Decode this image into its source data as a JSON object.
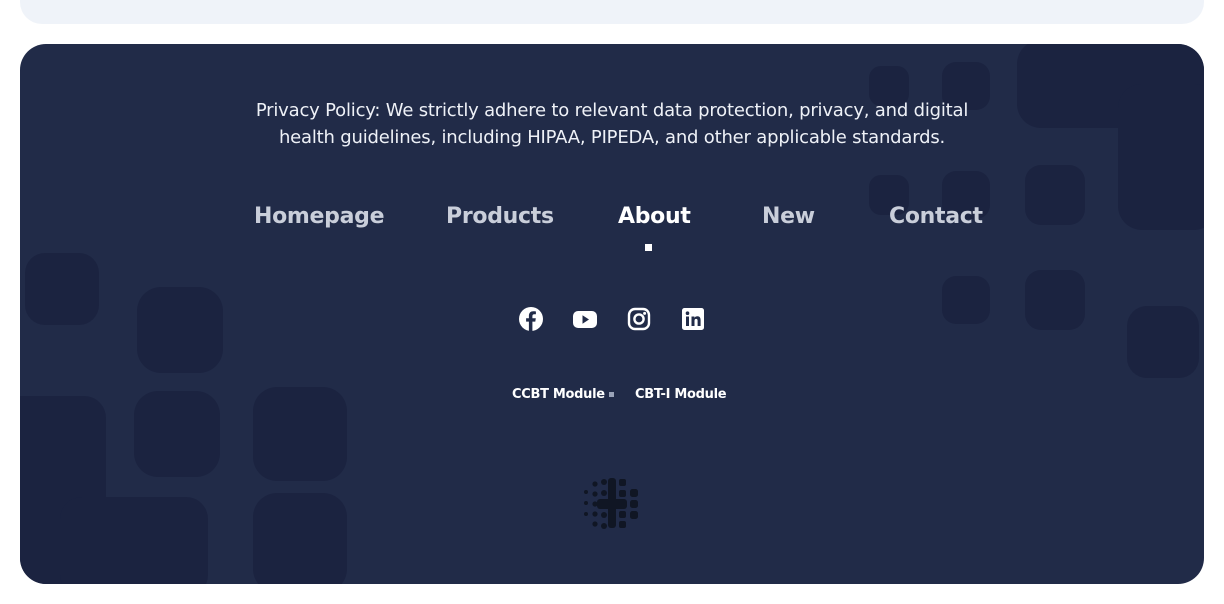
{
  "privacy": {
    "text": "Privacy Policy: We strictly adhere to relevant data protection, privacy, and digital health guidelines, including HIPAA, PIPEDA, and other applicable standards."
  },
  "nav": {
    "items": [
      {
        "label": "Homepage"
      },
      {
        "label": "Products"
      },
      {
        "label": "About",
        "active": true
      },
      {
        "label": "New"
      },
      {
        "label": "Contact"
      }
    ]
  },
  "socials": [
    "facebook-icon",
    "youtube-icon",
    "instagram-icon",
    "linkedin-icon"
  ],
  "links": {
    "ccbt": "CCBT Module",
    "cbti": "CBT-I Module"
  },
  "colors": {
    "footer_bg": "#212b48",
    "deco": "#1b2340",
    "top_card": "#eff3f9"
  }
}
